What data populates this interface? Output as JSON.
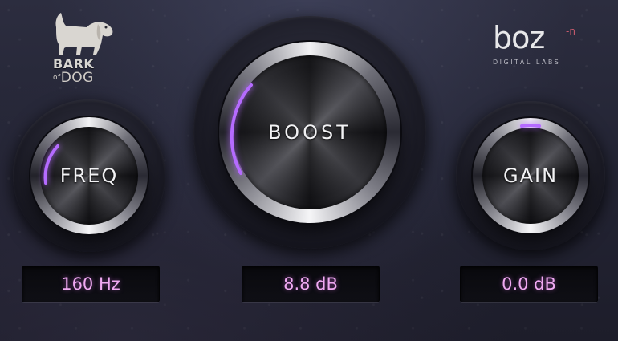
{
  "brand": {
    "left_logo_line1": "BARK",
    "left_logo_small": "of",
    "left_logo_line2": "DOG",
    "right_logo_word": "boz",
    "right_logo_sup": "-n",
    "right_logo_sub": "DIGITAL LABS"
  },
  "knobs": {
    "freq": {
      "label": "FREQ",
      "value": "160 Hz",
      "level": 0.22
    },
    "boost": {
      "label": "BOOST",
      "value": "8.8 dB",
      "level": 0.3
    },
    "gain": {
      "label": "GAIN",
      "value": "0.0 dB",
      "level": 0.5
    }
  },
  "colors": {
    "accent": "#b56bff",
    "display_text": "#f0a9f2",
    "panel": "#252636"
  },
  "icons": [
    "dog-icon"
  ]
}
